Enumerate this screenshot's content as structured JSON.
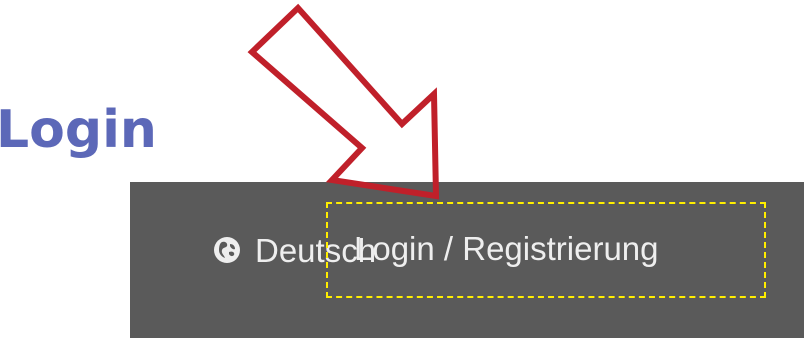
{
  "heading": {
    "text": "Login"
  },
  "topbar": {
    "language_label": "Deutsch",
    "language_icon": "globe-icon",
    "login_label": "Login / Registrierung"
  },
  "annotation": {
    "arrow_icon": "down-left-arrow-icon",
    "arrow_color": "#c0202a",
    "highlight_color": "#ffee00"
  },
  "colors": {
    "heading": "#5c68b8",
    "topbar_bg": "#5a5a5a",
    "topbar_text": "#eeeeee"
  }
}
